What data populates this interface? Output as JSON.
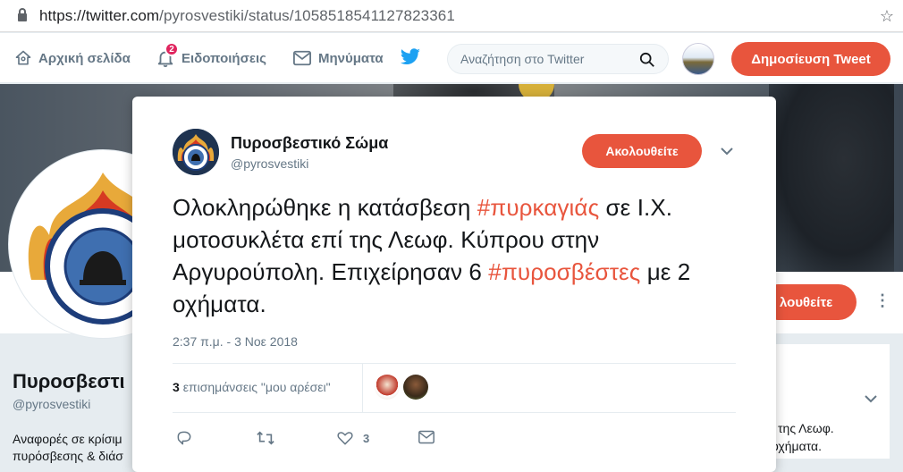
{
  "browser": {
    "url_host": "https://twitter.com",
    "url_path": "/pyrosvestiki/status/1058518541127823361"
  },
  "nav": {
    "home_label": "Αρχική σελίδα",
    "notifications_label": "Ειδοποιήσεις",
    "notifications_badge": "2",
    "messages_label": "Μηνύματα",
    "search_placeholder": "Αναζήτηση στο Twitter",
    "tweet_button": "Δημοσίευση Tweet"
  },
  "profile": {
    "name_partial": "Πυροσβεστι",
    "handle": "@pyrosvestiki",
    "bio_partial_1": "Αναφορές σε κρίσιμ",
    "bio_partial_2": "πυρόσβεσης & διάσ",
    "follow_partial": "λουθείτε",
    "right_text_1": "ί της Λεωφ.",
    "right_text_2": "οχήματα."
  },
  "tweet": {
    "author_name": "Πυροσβεστικό Σώμα",
    "author_handle": "@pyrosvestiki",
    "follow_label": "Ακολουθείτε",
    "text_part1": "Ολοκληρώθηκε η κατάσβεση ",
    "hashtag1": "#πυρκαγιάς",
    "text_part2": " σε Ι.Χ. μοτοσυκλέτα επί της Λεωφ. Κύπρου στην Αργυρούπολη.  Επιχείρησαν 6 ",
    "hashtag2": "#πυροσβέστες",
    "text_part3": " με 2 οχήματα.",
    "timestamp": "2:37 π.μ. - 3 Νοε 2018",
    "likes_count": "3",
    "likes_label": "επισημάνσεις \"μου αρέσει\"",
    "action_like_count": "3"
  },
  "colors": {
    "accent": "#e8553d",
    "twitter_blue": "#1da1f2",
    "muted": "#657786"
  }
}
